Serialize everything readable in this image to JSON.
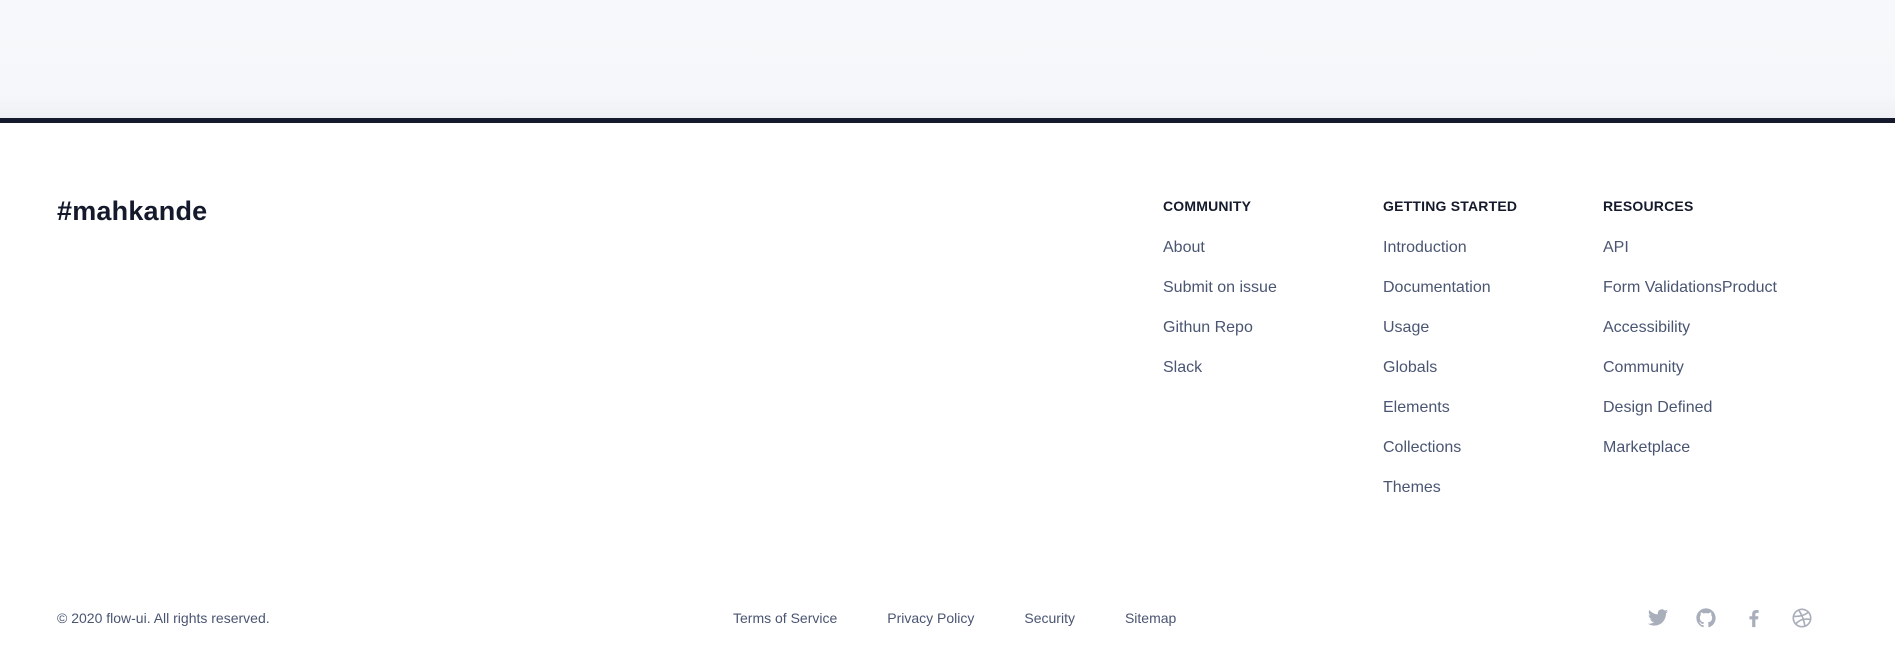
{
  "brand": "#mahkande",
  "columns": {
    "community": {
      "heading": "COMMUNITY",
      "links": [
        "About",
        "Submit on issue",
        "Githun Repo",
        "Slack"
      ]
    },
    "getting_started": {
      "heading": "GETTING STARTED",
      "links": [
        "Introduction",
        "Documentation",
        "Usage",
        "Globals",
        "Elements",
        "Collections",
        "Themes"
      ]
    },
    "resources": {
      "heading": "RESOURCES",
      "links": [
        "API",
        "Form ValidationsProduct",
        "Accessibility",
        "Community",
        "Design Defined",
        "Marketplace"
      ]
    }
  },
  "footer": {
    "copyright": "© 2020 flow-ui. All rights reserved.",
    "legal_links": [
      "Terms of Service",
      "Privacy Policy",
      "Security",
      "Sitemap"
    ],
    "social_icons": [
      "twitter-icon",
      "github-icon",
      "facebook-icon",
      "dribbble-icon"
    ]
  },
  "colors": {
    "dark": "#141a2b",
    "link": "#4a5572",
    "icon": "#a9aebb",
    "band": "#f7f8fb"
  }
}
